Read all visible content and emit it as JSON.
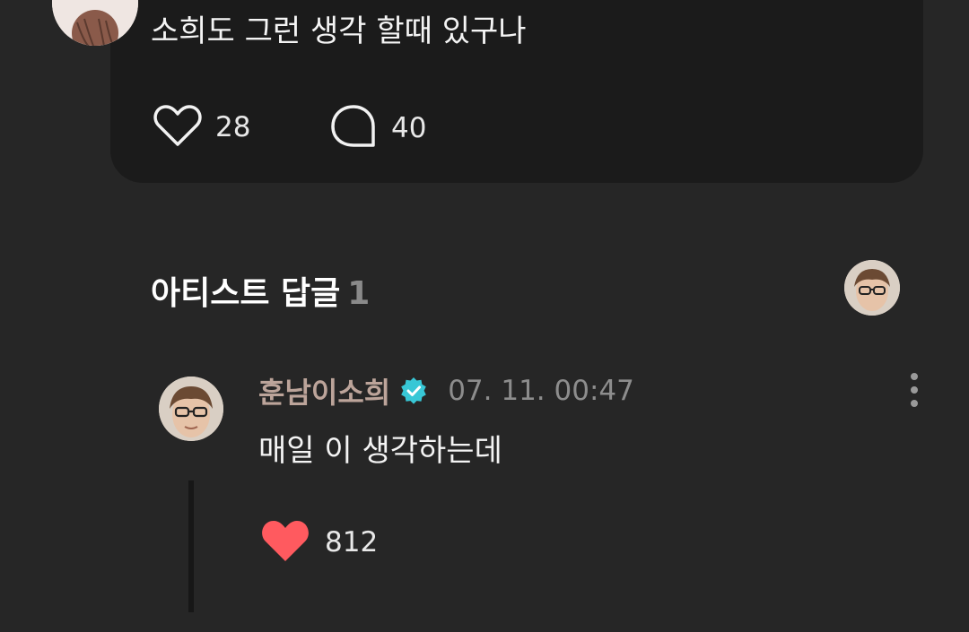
{
  "post": {
    "text": "소희도 그런 생각 할때 있구나",
    "like_count": "28",
    "comment_count": "40"
  },
  "section": {
    "title": "아티스트 답글",
    "count": "1"
  },
  "reply": {
    "author": "훈남이소희",
    "timestamp": "07. 11. 00:47",
    "text": "매일 이 생각하는데",
    "like_count": "812"
  },
  "icons": {
    "like": "heart-outline-icon",
    "comment": "speech-bubble-icon",
    "verified": "verified-badge-icon",
    "more": "more-vertical-icon",
    "reply_like": "heart-filled-icon"
  },
  "colors": {
    "background": "#262626",
    "card": "#1b1b1b",
    "liked_heart": "#ff5a5f",
    "verified": "#38c7d6",
    "author_name": "#bca49a"
  }
}
